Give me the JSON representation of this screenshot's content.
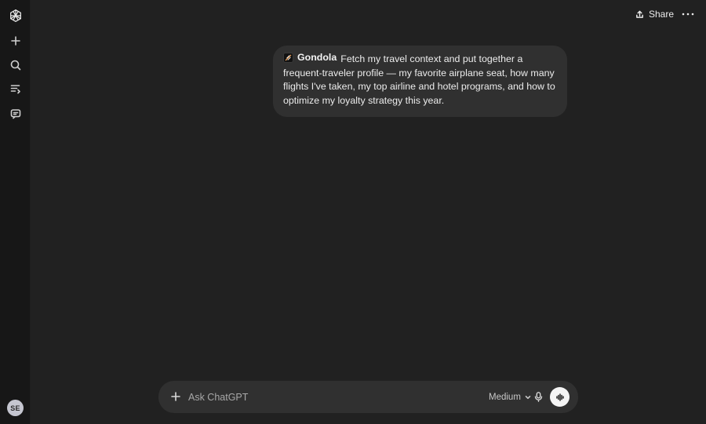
{
  "sidebar": {
    "logo_icon": "openai-logo-icon",
    "items": [
      {
        "name": "new-chat",
        "icon": "plus-icon"
      },
      {
        "name": "search-chats",
        "icon": "search-icon"
      },
      {
        "name": "library",
        "icon": "library-icon"
      },
      {
        "name": "chats",
        "icon": "chat-bubble-icon"
      }
    ],
    "avatar_initials": "SE"
  },
  "header": {
    "share_label": "Share",
    "share_icon": "share-icon",
    "more_icon": "more-horizontal-icon"
  },
  "conversation": {
    "user_message": {
      "app_chip_label": "Gondola",
      "app_chip_icon": "gondola-app-icon",
      "text": "Fetch my travel context and put together a frequent-traveler profile — my favorite airplane seat, how many flights I've taken, my top airline and hotel programs, and how to optimize my loyalty strategy this year."
    }
  },
  "composer": {
    "placeholder": "Ask ChatGPT",
    "value": "",
    "model_label": "Medium",
    "plus_icon": "plus-icon",
    "mic_icon": "microphone-icon",
    "voice_icon": "voice-mode-icon"
  },
  "colors": {
    "background": "#212121",
    "sidebar": "#171717",
    "bubble": "#303030",
    "text": "#ececec",
    "avatar": "#c5c6d0"
  }
}
